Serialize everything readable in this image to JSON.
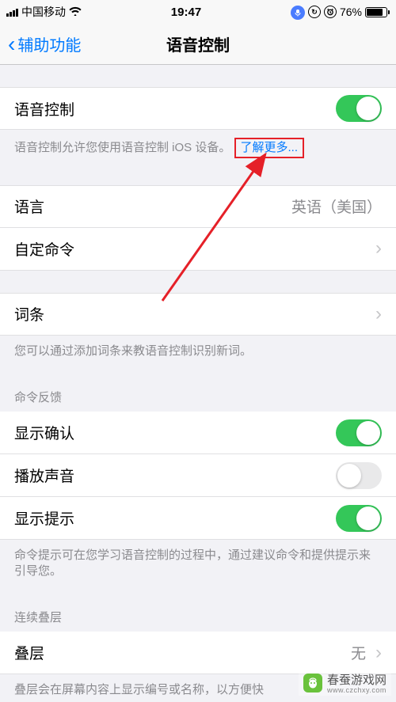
{
  "status": {
    "carrier": "中国移动",
    "time": "19:47",
    "battery_pct": "76%"
  },
  "nav": {
    "back": "辅助功能",
    "title": "语音控制"
  },
  "main_toggle": {
    "label": "语音控制",
    "on": true,
    "footer": "语音控制允许您使用语音控制 iOS 设备。",
    "learn_more": "了解更多..."
  },
  "lang_group": {
    "language_label": "语言",
    "language_value": "英语（美国）",
    "custom_cmd_label": "自定命令"
  },
  "vocab_group": {
    "vocab_label": "词条",
    "vocab_footer": "您可以通过添加词条来教语音控制识别新词。"
  },
  "feedback": {
    "header": "命令反馈",
    "show_confirm": "显示确认",
    "play_sound": "播放声音",
    "show_hint": "显示提示",
    "footer": "命令提示可在您学习语音控制的过程中，通过建议命令和提供提示来引导您。"
  },
  "overlay": {
    "header": "连续叠层",
    "row_label": "叠层",
    "row_value": "无",
    "footer": "叠层会在屏幕内容上显示编号或名称，以方便快"
  },
  "watermark": {
    "name": "春蚕游戏网",
    "url": "www.czchxy.com"
  }
}
